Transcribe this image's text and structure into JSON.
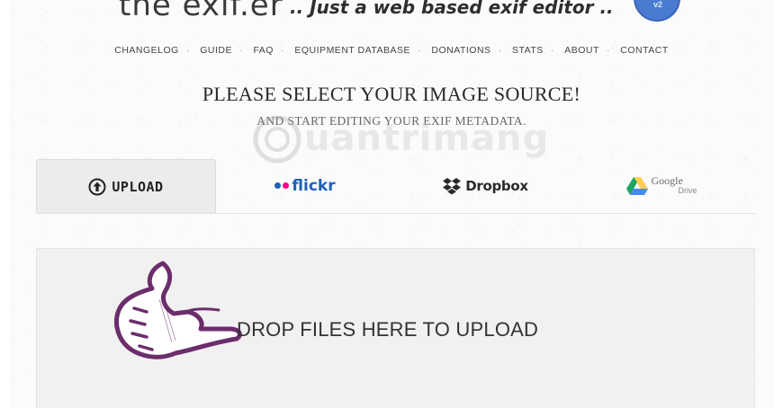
{
  "header": {
    "logo_text": "the exif.er",
    "tagline": ".. Just a web based exif editor ..",
    "badge_text": "v2"
  },
  "nav": {
    "items": [
      "CHANGELOG",
      "GUIDE",
      "FAQ",
      "EQUIPMENT DATABASE",
      "DONATIONS",
      "STATS",
      "ABOUT",
      "CONTACT"
    ]
  },
  "main": {
    "heading": "PLEASE SELECT YOUR IMAGE SOURCE!",
    "subheading": "AND START EDITING YOUR EXIF METADATA."
  },
  "watermark": {
    "text": "uantrimang"
  },
  "tabs": [
    {
      "label": "UPLOAD",
      "icon": "upload-arrow-icon",
      "active": true
    },
    {
      "label": "flickr",
      "icon": "flickr-dots-icon",
      "active": false
    },
    {
      "label": "Dropbox",
      "icon": "dropbox-icon",
      "active": false
    },
    {
      "label_google": "Google",
      "label_drive": "Drive",
      "icon": "google-drive-icon",
      "active": false
    }
  ],
  "dropzone": {
    "text": "DROP FILES HERE TO UPLOAD",
    "icon": "pointing-hand-icon"
  },
  "colors": {
    "flickr_pink": "#ff0084",
    "flickr_blue": "#0063dc",
    "hand_outline": "#6b2d6b",
    "gdrive_green": "#1fa463",
    "gdrive_yellow": "#ffd04b",
    "gdrive_blue": "#4688f4"
  }
}
